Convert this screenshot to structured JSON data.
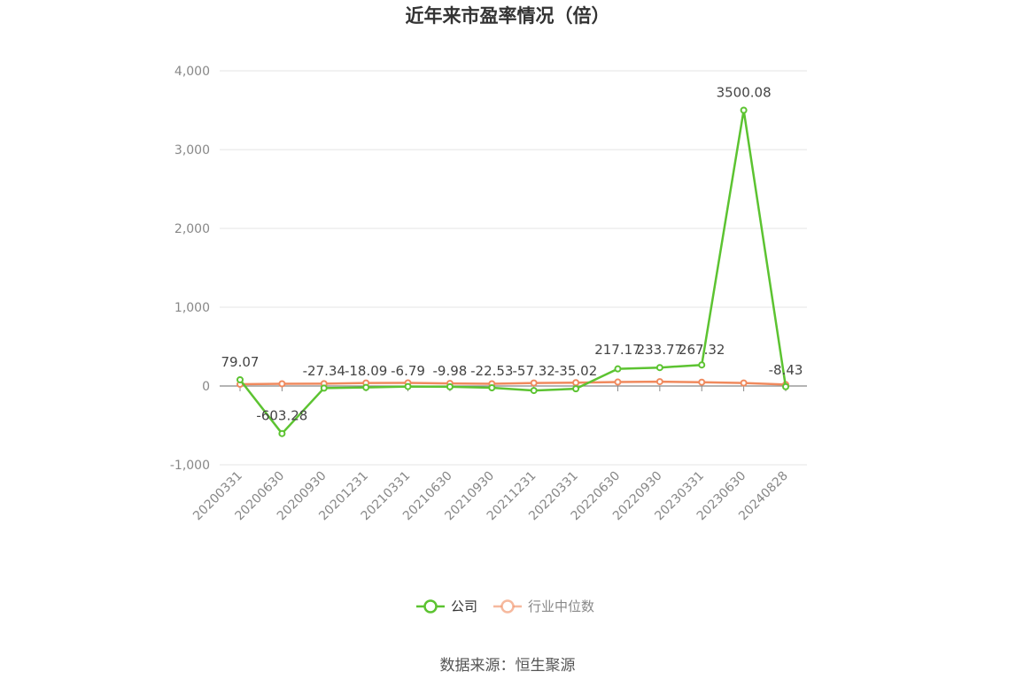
{
  "chart_data": {
    "type": "line",
    "title": "近年来市盈率情况（倍）",
    "categories": [
      "20200331",
      "20200630",
      "20200930",
      "20201231",
      "20210331",
      "20210630",
      "20210930",
      "20211231",
      "20220331",
      "20220630",
      "20220930",
      "20230331",
      "20230630",
      "20240828"
    ],
    "series": [
      {
        "name": "公司",
        "color": "#5cc331",
        "values": [
          79.07,
          -603.28,
          -27.34,
          -18.09,
          -6.79,
          -9.98,
          -22.53,
          -57.32,
          -35.02,
          217.17,
          233.77,
          267.32,
          3500.08,
          -8.43
        ],
        "labels": [
          "79.07",
          "-603.28",
          "-27.34",
          "-18.09",
          "-6.79",
          "-9.98",
          "-22.53",
          "-57.32",
          "-35.02",
          "217.17",
          "233.77",
          "267.32",
          "3500.08",
          "-8.43"
        ]
      },
      {
        "name": "行业中位数",
        "color": "#f08a5e",
        "values": [
          22,
          28,
          30,
          38,
          40,
          33,
          28,
          38,
          42,
          50,
          55,
          48,
          38,
          18
        ]
      }
    ],
    "ylim": [
      -1000,
      4000
    ],
    "yticks": [
      -1000,
      0,
      1000,
      2000,
      3000,
      4000
    ],
    "ytick_labels": [
      "-1,000",
      "0",
      "1,000",
      "2,000",
      "3,000",
      "4,000"
    ],
    "grid": true,
    "legend_position": "bottom-center",
    "source": "数据来源：恒生聚源"
  }
}
